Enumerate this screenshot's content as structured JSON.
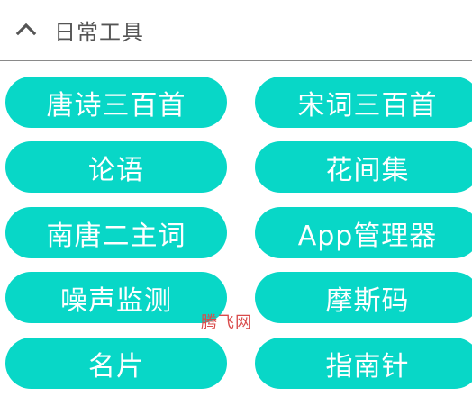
{
  "header": {
    "title": "日常工具",
    "collapse_icon": "chevron-up-icon"
  },
  "colors": {
    "button_bg": "#08D7C7",
    "button_text": "#FFFFFF",
    "title_text": "#555555",
    "watermark": "#D94B4B"
  },
  "tools": [
    {
      "label": "唐诗三百首"
    },
    {
      "label": "宋词三百首"
    },
    {
      "label": "论语"
    },
    {
      "label": "花间集"
    },
    {
      "label": "南唐二主词"
    },
    {
      "label": "App管理器"
    },
    {
      "label": "噪声监测"
    },
    {
      "label": "摩斯码"
    },
    {
      "label": "名片"
    },
    {
      "label": "指南针"
    }
  ],
  "watermark": {
    "text": "腾飞网"
  }
}
